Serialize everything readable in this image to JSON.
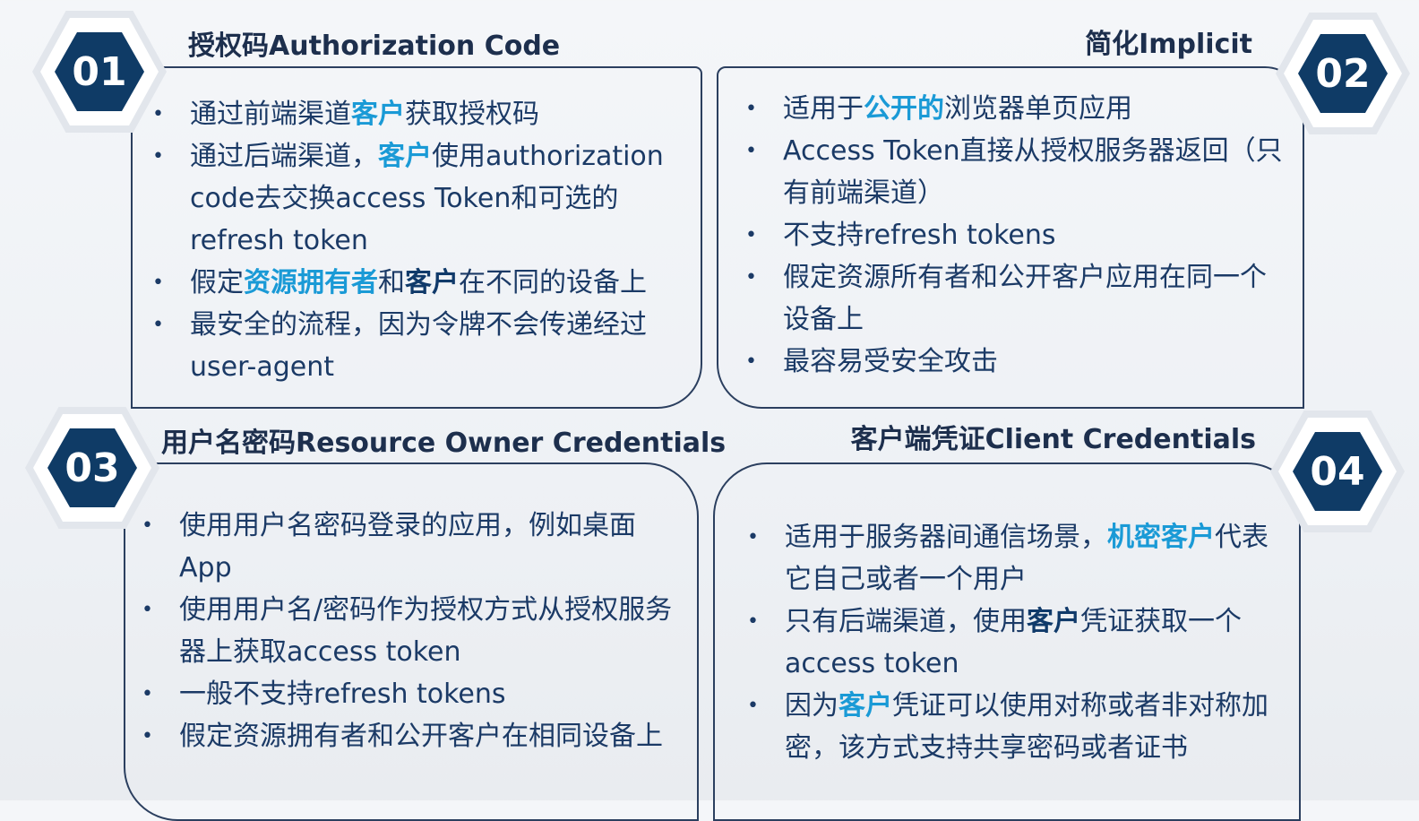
{
  "quadrants": [
    {
      "number": "01",
      "title": "授权码Authorization Code",
      "items": [
        [
          {
            "t": "通过前端渠道",
            "s": "n"
          },
          {
            "t": "客户",
            "s": "hl"
          },
          {
            "t": "获取授权码",
            "s": "n"
          }
        ],
        [
          {
            "t": "通过后端渠道，",
            "s": "n"
          },
          {
            "t": "客户",
            "s": "hl"
          },
          {
            "t": "使用authorization code去交换access Token和可选的refresh token",
            "s": "n"
          }
        ],
        [
          {
            "t": "假定",
            "s": "n"
          },
          {
            "t": "资源拥有者",
            "s": "hl"
          },
          {
            "t": "和",
            "s": "n"
          },
          {
            "t": "客户",
            "s": "bd"
          },
          {
            "t": "在不同的设备上",
            "s": "n"
          }
        ],
        [
          {
            "t": "最安全的流程，因为令牌不会传递经过user-agent",
            "s": "n"
          }
        ]
      ]
    },
    {
      "number": "02",
      "title": "简化Implicit",
      "items": [
        [
          {
            "t": "适用于",
            "s": "n"
          },
          {
            "t": "公开的",
            "s": "hl"
          },
          {
            "t": "浏览器单页应用",
            "s": "n"
          }
        ],
        [
          {
            "t": "Access Token直接从授权服务器返回（只有前端渠道）",
            "s": "n"
          }
        ],
        [
          {
            "t": "不支持refresh tokens",
            "s": "n"
          }
        ],
        [
          {
            "t": "假定资源所有者和公开客户应用在同一个设备上",
            "s": "n"
          }
        ],
        [
          {
            "t": "最容易受安全攻击",
            "s": "n"
          }
        ]
      ]
    },
    {
      "number": "03",
      "title": "用户名密码Resource Owner Credentials",
      "items": [
        [
          {
            "t": "使用用户名密码登录的应用，例如桌面App",
            "s": "n"
          }
        ],
        [
          {
            "t": "使用用户名/密码作为授权方式从授权服务器上获取access token",
            "s": "n"
          }
        ],
        [
          {
            "t": "一般不支持refresh tokens",
            "s": "n"
          }
        ],
        [
          {
            "t": "假定资源拥有者和公开客户在相同设备上",
            "s": "n"
          }
        ]
      ]
    },
    {
      "number": "04",
      "title": "客户端凭证Client Credentials",
      "items": [
        [
          {
            "t": "适用于服务器间通信场景，",
            "s": "n"
          },
          {
            "t": "机密客户",
            "s": "hl"
          },
          {
            "t": "代表它自己或者一个用户",
            "s": "n"
          }
        ],
        [
          {
            "t": "只有后端渠道，使用",
            "s": "n"
          },
          {
            "t": "客户",
            "s": "bd"
          },
          {
            "t": "凭证获取一个access token",
            "s": "n"
          }
        ],
        [
          {
            "t": "因为",
            "s": "n"
          },
          {
            "t": "客户",
            "s": "hl"
          },
          {
            "t": "凭证可以使用对称或者非对称加密，该方式支持共享密码或者证书",
            "s": "n"
          }
        ]
      ]
    }
  ],
  "colors": {
    "hex_fill": "#0f3b66",
    "highlight": "#1a9ad6",
    "text": "#1b3a66",
    "border": "#2b3f5f"
  }
}
